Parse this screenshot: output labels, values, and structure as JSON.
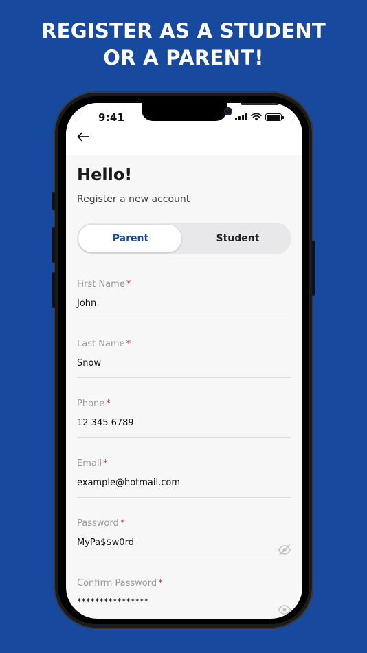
{
  "banner": {
    "line1": "REGISTER AS A STUDENT",
    "line2": "OR A PARENT!"
  },
  "status_bar": {
    "time": "9:41",
    "icons": [
      "signal-icon",
      "wifi-icon",
      "battery-icon"
    ]
  },
  "nav": {
    "back_icon": "arrow-left-icon"
  },
  "header": {
    "title": "Hello!",
    "subtitle": "Register a new account"
  },
  "role_toggle": {
    "options": [
      "Parent",
      "Student"
    ],
    "selected": "Parent"
  },
  "form": {
    "fields": [
      {
        "label": "First Name",
        "required": "*",
        "value": "John"
      },
      {
        "label": "Last Name",
        "required": "*",
        "value": "Snow"
      },
      {
        "label": "Phone",
        "required": "*",
        "value": "12 345 6789"
      },
      {
        "label": "Email",
        "required": "*",
        "value": "example@hotmail.com"
      },
      {
        "label": "Password",
        "required": "*",
        "value": "MyPa$$w0rd",
        "icon": "eye-off-icon"
      },
      {
        "label": "Confirm Password",
        "required": "*",
        "value": "****************",
        "icon": "eye-icon"
      }
    ]
  },
  "colors": {
    "brand_blue": "#174a9e",
    "required": "#d23030",
    "screen_bg": "#f7f7f7"
  }
}
